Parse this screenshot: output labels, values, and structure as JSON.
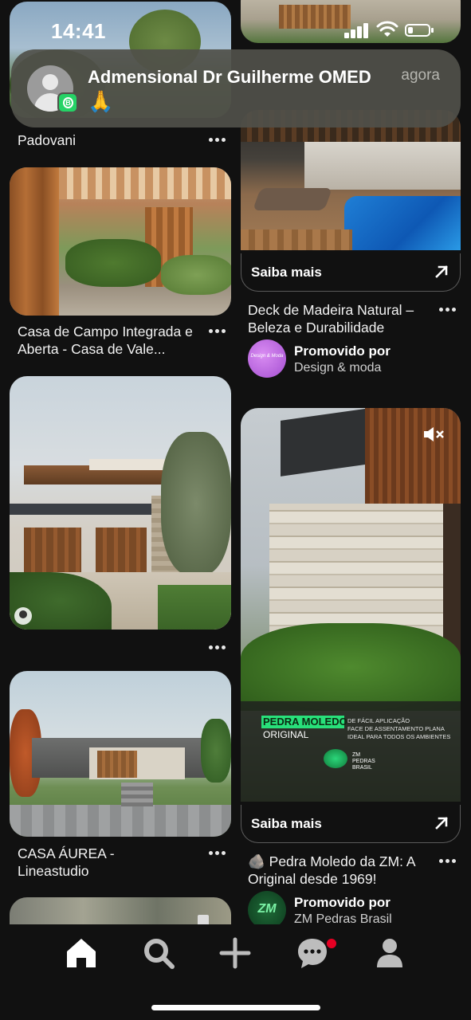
{
  "status_bar": {
    "time": "14:41"
  },
  "notification": {
    "app_icon": "whatsapp-business-icon",
    "sender": "Admensional Dr Guilherme  OMED",
    "message": "🙏",
    "time": "agora"
  },
  "feed": {
    "left": [
      {
        "caption": "Padovani"
      },
      {
        "caption": "Casa de Campo Integrada e Aberta - Casa de Vale..."
      },
      {
        "caption": ""
      },
      {
        "caption": "CASA ÁUREA - Lineastudio"
      }
    ],
    "right": [
      {
        "cta": "Saiba mais",
        "title": "Deck de Madeira Natural – Beleza e Durabilidade",
        "promoted_label": "Promovido por",
        "advertiser": "Design & moda",
        "advertiser_logo_text": "Design & Moda"
      },
      {
        "overlay": {
          "headline": "PEDRA MOLEDO",
          "subhead": "ORIGINAL",
          "line1": "DE FÁCIL APLICAÇÃO",
          "line2": "FACE DE ASSENTAMENTO PLANA",
          "line3": "IDEAL PARA TODOS OS AMBIENTES",
          "brand": "ZM PEDRAS BRASIL"
        },
        "cta": "Saiba mais",
        "title": "🪨 Pedra Moledo da ZM: A Original desde 1969!",
        "promoted_label": "Promovido por",
        "advertiser": "ZM Pedras Brasil",
        "advertiser_logo_text": "ZM"
      }
    ]
  },
  "tabbar": {
    "items": [
      {
        "icon": "home-icon",
        "active": true
      },
      {
        "icon": "search-icon",
        "active": false
      },
      {
        "icon": "plus-icon",
        "active": false
      },
      {
        "icon": "chat-icon",
        "active": false,
        "badge": true
      },
      {
        "icon": "profile-icon",
        "active": false
      }
    ]
  },
  "colors": {
    "background": "#111111",
    "badge": "#e60023",
    "text": "#ffffff"
  }
}
